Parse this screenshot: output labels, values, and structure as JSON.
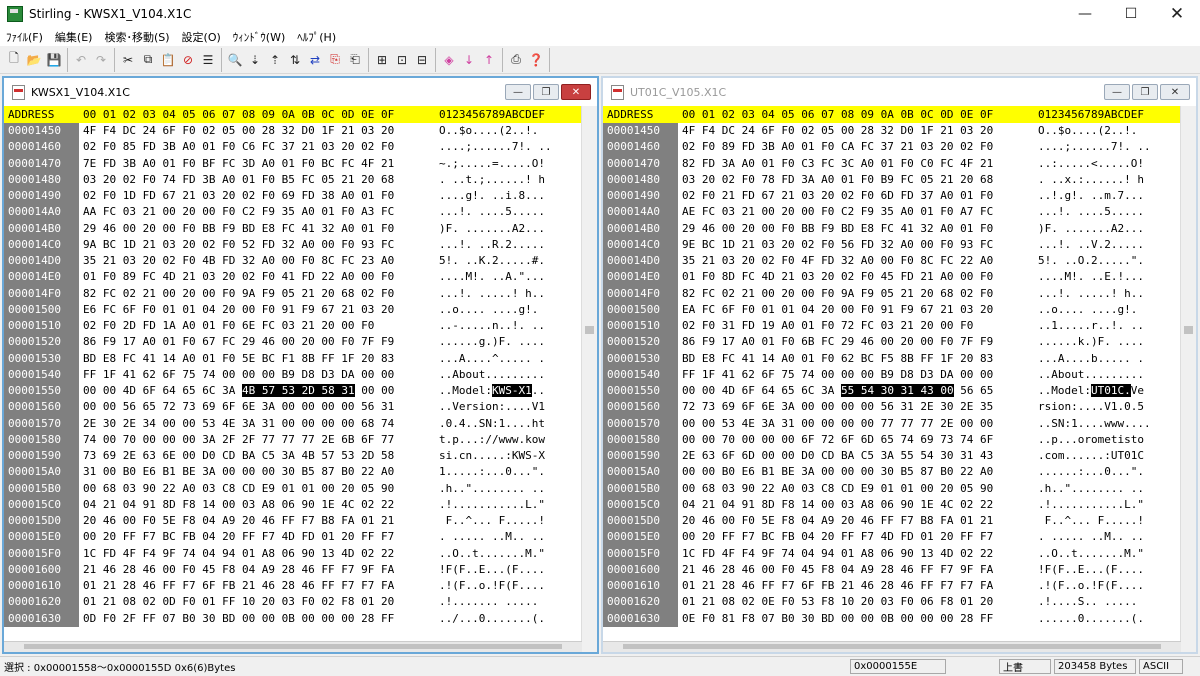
{
  "app": {
    "title": "Stirling - KWSX1_V104.X1C",
    "window_controls": {
      "minimize": "—",
      "maximize": "☐",
      "close": "✕"
    }
  },
  "menu": [
    "ﾌｧｲﾙ(F)",
    "編集(E)",
    "検索･移動(S)",
    "設定(O)",
    "ｳｨﾝﾄﾞｳ(W)",
    "ﾍﾙﾌﾟ(H)"
  ],
  "toolbar": {
    "groups": [
      [
        {
          "name": "new",
          "glyph": "🗋"
        },
        {
          "name": "open",
          "glyph": "📂"
        },
        {
          "name": "save",
          "glyph": "💾"
        }
      ],
      [
        {
          "name": "undo",
          "glyph": "↶",
          "dim": true
        },
        {
          "name": "redo",
          "glyph": "↷",
          "dim": true
        }
      ],
      [
        {
          "name": "cut",
          "glyph": "✂"
        },
        {
          "name": "copy",
          "glyph": "⧉"
        },
        {
          "name": "paste",
          "glyph": "📋",
          "dim": true
        },
        {
          "name": "delete",
          "glyph": "⊘",
          "red": true
        },
        {
          "name": "list",
          "glyph": "☰"
        }
      ],
      [
        {
          "name": "find",
          "glyph": "🔍"
        },
        {
          "name": "find-next",
          "glyph": "⇣"
        },
        {
          "name": "find-prev",
          "glyph": "⇡"
        },
        {
          "name": "find-all",
          "glyph": "⇅"
        },
        {
          "name": "find-replace",
          "glyph": "⇄",
          "blue": true
        },
        {
          "name": "replace",
          "glyph": "⎘",
          "red": true
        },
        {
          "name": "replace-all",
          "glyph": "⎗"
        }
      ],
      [
        {
          "name": "insert",
          "glyph": "⊞"
        },
        {
          "name": "insert-down",
          "glyph": "⊡"
        },
        {
          "name": "insert-right",
          "glyph": "⊟"
        }
      ],
      [
        {
          "name": "mark",
          "glyph": "◈",
          "pink": true
        },
        {
          "name": "mark-next",
          "glyph": "↓",
          "pink": true
        },
        {
          "name": "mark-prev",
          "glyph": "↑",
          "pink": true
        }
      ],
      [
        {
          "name": "print",
          "glyph": "⎙"
        },
        {
          "name": "help",
          "glyph": "❓",
          "red": true
        }
      ]
    ]
  },
  "header_row": {
    "address": "ADDRESS",
    "hex": "00 01 02 03 04 05 06 07 08 09 0A 0B 0C 0D 0E 0F",
    "ascii": "0123456789ABCDEF"
  },
  "windows": [
    {
      "title": "KWSX1_V104.X1C",
      "active": true,
      "controls": {
        "minimize": "—",
        "restore": "❐",
        "close": "✕"
      },
      "highlight": {
        "row": 11,
        "start": 11,
        "end": 15
      },
      "rows": [
        {
          "addr": "00001450",
          "hex": "4F F4 DC 24 6F F0 02 05 00 28 32 D0 1F 21 03 20",
          "ascii": "O..$o....(2..!. "
        },
        {
          "addr": "00001460",
          "hex": "02 F0 85 FD 3B A0 01 F0 C6 FC 37 21 03 20 02 F0",
          "ascii": "....;......7!. .."
        },
        {
          "addr": "00001470",
          "hex": "7E FD 3B A0 01 F0 BF FC 3D A0 01 F0 BC FC 4F 21",
          "ascii": "~.;.....=.....O!"
        },
        {
          "addr": "00001480",
          "hex": "03 20 02 F0 74 FD 3B A0 01 F0 B5 FC 05 21 20 68",
          "ascii": ". ..t.;......! h"
        },
        {
          "addr": "00001490",
          "hex": "02 F0 1D FD 67 21 03 20 02 F0 69 FD 38 A0 01 F0",
          "ascii": "....g!. ..i.8..."
        },
        {
          "addr": "000014A0",
          "hex": "AA FC 03 21 00 20 00 F0 C2 F9 35 A0 01 F0 A3 FC",
          "ascii": "...!. ....5....."
        },
        {
          "addr": "000014B0",
          "hex": "29 46 00 20 00 F0 BB F9 BD E8 FC 41 32 A0 01 F0",
          "ascii": ")F. .......A2..."
        },
        {
          "addr": "000014C0",
          "hex": "9A BC 1D 21 03 20 02 F0 52 FD 32 A0 00 F0 93 FC",
          "ascii": "...!. ..R.2....."
        },
        {
          "addr": "000014D0",
          "hex": "35 21 03 20 02 F0 4B FD 32 A0 00 F0 8C FC 23 A0",
          "ascii": "5!. ..K.2.....#."
        },
        {
          "addr": "000014E0",
          "hex": "01 F0 89 FC 4D 21 03 20 02 F0 41 FD 22 A0 00 F0",
          "ascii": "....M!. ..A.\"..."
        },
        {
          "addr": "000014F0",
          "hex": "82 FC 02 21 00 20 00 F0 9A F9 05 21 20 68 02 F0",
          "ascii": "...!. .....! h.."
        },
        {
          "addr": "00001500",
          "hex": "E6 FC 6F F0 01 01 04 20 00 F0 91 F9 67 21 03 20",
          "ascii": "..o.... ....g!. "
        },
        {
          "addr": "00001510",
          "hex": "02 F0 2D FD 1A A0 01 F0 6E FC 03 21 20 00 F0",
          "ascii": "..-.....n..!. .."
        },
        {
          "addr": "00001520",
          "hex": "86 F9 17 A0 01 F0 67 FC 29 46 00 20 00 F0 7F F9",
          "ascii": "......g.)F. ...."
        },
        {
          "addr": "00001530",
          "hex": "BD E8 FC 41 14 A0 01 F0 5E BC F1 8B FF 1F 20 83",
          "ascii": "...A....^..... ."
        },
        {
          "addr": "00001540",
          "hex": "FF 1F 41 62 6F 75 74 00 00 00 B9 D8 D3 DA 00 00",
          "ascii": "..About........."
        },
        {
          "addr": "00001550",
          "hex": "00 00 4D 6F 64 65 6C 3A 4B 57 53 2D 58 31 00 00",
          "ascii": "..Model:KWS-X1.."
        },
        {
          "addr": "00001560",
          "hex": "00 00 56 65 72 73 69 6F 6E 3A 00 00 00 00 56 31",
          "ascii": "..Version:....V1"
        },
        {
          "addr": "00001570",
          "hex": "2E 30 2E 34 00 00 53 4E 3A 31 00 00 00 00 68 74",
          "ascii": ".0.4..SN:1....ht"
        },
        {
          "addr": "00001580",
          "hex": "74 00 70 00 00 00 3A 2F 2F 77 77 77 2E 6B 6F 77",
          "ascii": "t.p...://www.kow"
        },
        {
          "addr": "00001590",
          "hex": "73 69 2E 63 6E 00 D0 CD BA C5 3A 4B 57 53 2D 58",
          "ascii": "si.cn.....:KWS-X"
        },
        {
          "addr": "000015A0",
          "hex": "31 00 B0 E6 B1 BE 3A 00 00 00 30 B5 87 B0 22 A0",
          "ascii": "1.....:...0...\"."
        },
        {
          "addr": "000015B0",
          "hex": "00 68 03 90 22 A0 03 C8 CD E9 01 01 00 20 05 90",
          "ascii": ".h..\"........ .."
        },
        {
          "addr": "000015C0",
          "hex": "04 21 04 91 8D F8 14 00 03 A8 06 90 1E 4C 02 22",
          "ascii": ".!...........L.\""
        },
        {
          "addr": "000015D0",
          "hex": "20 46 00 F0 5E F8 04 A9 20 46 FF F7 B8 FA 01 21",
          "ascii": " F..^... F.....!"
        },
        {
          "addr": "000015E0",
          "hex": "00 20 FF F7 BC FB 04 20 FF F7 4D FD 01 20 FF F7",
          "ascii": ". ..... ..M.. .."
        },
        {
          "addr": "000015F0",
          "hex": "1C FD 4F F4 9F 74 04 94 01 A8 06 90 13 4D 02 22",
          "ascii": "..O..t.......M.\""
        },
        {
          "addr": "00001600",
          "hex": "21 46 28 46 00 F0 45 F8 04 A9 28 46 FF F7 9F FA",
          "ascii": "!F(F..E...(F...."
        },
        {
          "addr": "00001610",
          "hex": "01 21 28 46 FF F7 6F FB 21 46 28 46 FF F7 F7 FA",
          "ascii": ".!(F..o.!F(F...."
        },
        {
          "addr": "00001620",
          "hex": "01 21 08 02 0D F0 01 FF 10 20 03 F0 02 F8 01 20",
          "ascii": ".!....... ..... "
        },
        {
          "addr": "00001630",
          "hex": "0D F0 2F FF 07 B0 30 BD 00 00 0B 00 00 00 28 FF",
          "ascii": "../...0.......(."
        }
      ]
    },
    {
      "title": "UT01C_V105.X1C",
      "active": false,
      "controls": {
        "minimize": "—",
        "restore": "❐",
        "close": "✕"
      },
      "highlight": {
        "row": 11,
        "start": 11,
        "end": 15
      },
      "rows": [
        {
          "addr": "00001450",
          "hex": "4F F4 DC 24 6F F0 02 05 00 28 32 D0 1F 21 03 20",
          "ascii": "O..$o....(2..!. "
        },
        {
          "addr": "00001460",
          "hex": "02 F0 89 FD 3B A0 01 F0 CA FC 37 21 03 20 02 F0",
          "ascii": "....;......7!. .."
        },
        {
          "addr": "00001470",
          "hex": "82 FD 3A A0 01 F0 C3 FC 3C A0 01 F0 C0 FC 4F 21",
          "ascii": "..:.....<.....O!"
        },
        {
          "addr": "00001480",
          "hex": "03 20 02 F0 78 FD 3A A0 01 F0 B9 FC 05 21 20 68",
          "ascii": ". ..x.:......! h"
        },
        {
          "addr": "00001490",
          "hex": "02 F0 21 FD 67 21 03 20 02 F0 6D FD 37 A0 01 F0",
          "ascii": "..!.g!. ..m.7..."
        },
        {
          "addr": "000014A0",
          "hex": "AE FC 03 21 00 20 00 F0 C2 F9 35 A0 01 F0 A7 FC",
          "ascii": "...!. ....5....."
        },
        {
          "addr": "000014B0",
          "hex": "29 46 00 20 00 F0 BB F9 BD E8 FC 41 32 A0 01 F0",
          "ascii": ")F. .......A2..."
        },
        {
          "addr": "000014C0",
          "hex": "9E BC 1D 21 03 20 02 F0 56 FD 32 A0 00 F0 93 FC",
          "ascii": "...!. ..V.2....."
        },
        {
          "addr": "000014D0",
          "hex": "35 21 03 20 02 F0 4F FD 32 A0 00 F0 8C FC 22 A0",
          "ascii": "5!. ..O.2.....\"."
        },
        {
          "addr": "000014E0",
          "hex": "01 F0 8D FC 4D 21 03 20 02 F0 45 FD 21 A0 00 F0",
          "ascii": "....M!. ..E.!..."
        },
        {
          "addr": "000014F0",
          "hex": "82 FC 02 21 00 20 00 F0 9A F9 05 21 20 68 02 F0",
          "ascii": "...!. .....! h.."
        },
        {
          "addr": "00001500",
          "hex": "EA FC 6F F0 01 01 04 20 00 F0 91 F9 67 21 03 20",
          "ascii": "..o.... ....g!. "
        },
        {
          "addr": "00001510",
          "hex": "02 F0 31 FD 19 A0 01 F0 72 FC 03 21 20 00 F0",
          "ascii": "..1.....r..!. .."
        },
        {
          "addr": "00001520",
          "hex": "86 F9 17 A0 01 F0 6B FC 29 46 00 20 00 F0 7F F9",
          "ascii": "......k.)F. ...."
        },
        {
          "addr": "00001530",
          "hex": "BD E8 FC 41 14 A0 01 F0 62 BC F5 8B FF 1F 20 83",
          "ascii": "...A....b..... ."
        },
        {
          "addr": "00001540",
          "hex": "FF 1F 41 62 6F 75 74 00 00 00 B9 D8 D3 DA 00 00",
          "ascii": "..About........."
        },
        {
          "addr": "00001550",
          "hex": "00 00 4D 6F 64 65 6C 3A 55 54 30 31 43 00 56 65",
          "ascii": "..Model:UT01C.Ve"
        },
        {
          "addr": "00001560",
          "hex": "72 73 69 6F 6E 3A 00 00 00 00 56 31 2E 30 2E 35",
          "ascii": "rsion:....V1.0.5"
        },
        {
          "addr": "00001570",
          "hex": "00 00 53 4E 3A 31 00 00 00 00 77 77 77 2E 00 00",
          "ascii": "..SN:1....www...."
        },
        {
          "addr": "00001580",
          "hex": "00 00 70 00 00 00 6F 72 6F 6D 65 74 69 73 74 6F",
          "ascii": "..p...orometisto"
        },
        {
          "addr": "00001590",
          "hex": "2E 63 6F 6D 00 00 D0 CD BA C5 3A 55 54 30 31 43",
          "ascii": ".com......:UT01C"
        },
        {
          "addr": "000015A0",
          "hex": "00 00 B0 E6 B1 BE 3A 00 00 00 30 B5 87 B0 22 A0",
          "ascii": "......:...0...\"."
        },
        {
          "addr": "000015B0",
          "hex": "00 68 03 90 22 A0 03 C8 CD E9 01 01 00 20 05 90",
          "ascii": ".h..\"........ .."
        },
        {
          "addr": "000015C0",
          "hex": "04 21 04 91 8D F8 14 00 03 A8 06 90 1E 4C 02 22",
          "ascii": ".!...........L.\""
        },
        {
          "addr": "000015D0",
          "hex": "20 46 00 F0 5E F8 04 A9 20 46 FF F7 B8 FA 01 21",
          "ascii": " F..^... F.....!"
        },
        {
          "addr": "000015E0",
          "hex": "00 20 FF F7 BC FB 04 20 FF F7 4D FD 01 20 FF F7",
          "ascii": ". ..... ..M.. .."
        },
        {
          "addr": "000015F0",
          "hex": "1C FD 4F F4 9F 74 04 94 01 A8 06 90 13 4D 02 22",
          "ascii": "..O..t.......M.\""
        },
        {
          "addr": "00001600",
          "hex": "21 46 28 46 00 F0 45 F8 04 A9 28 46 FF F7 9F FA",
          "ascii": "!F(F..E...(F...."
        },
        {
          "addr": "00001610",
          "hex": "01 21 28 46 FF F7 6F FB 21 46 28 46 FF F7 F7 FA",
          "ascii": ".!(F..o.!F(F...."
        },
        {
          "addr": "00001620",
          "hex": "01 21 08 02 0E F0 53 F8 10 20 03 F0 06 F8 01 20",
          "ascii": ".!....S.. ..... "
        },
        {
          "addr": "00001630",
          "hex": "0E F0 81 F8 07 B0 30 BD 00 00 0B 00 00 00 28 FF",
          "ascii": "......0.......(."
        }
      ]
    }
  ],
  "status": {
    "selection": "選択 : 0x00001558～0x0000155D  0x6(6)Bytes",
    "cursor": "0x0000155E",
    "mode": "上書",
    "size": "203458 Bytes",
    "charset": "ASCII"
  }
}
